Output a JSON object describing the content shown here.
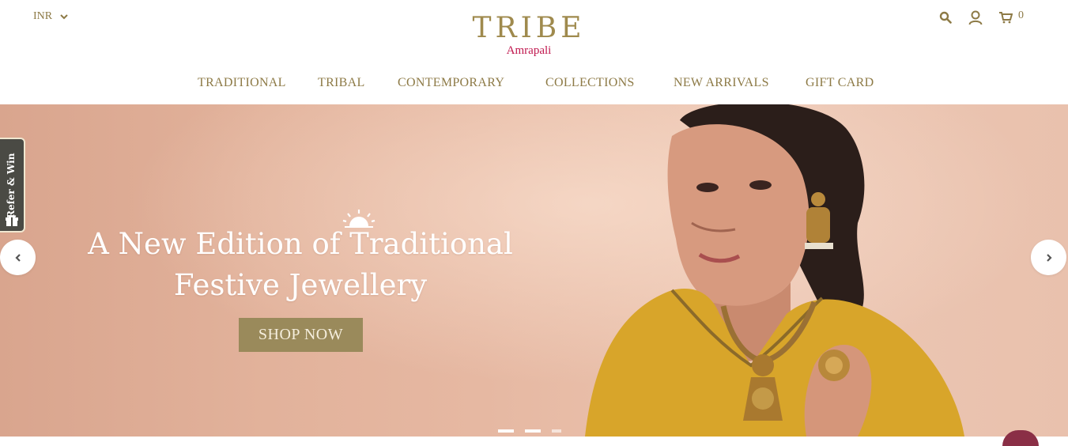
{
  "header": {
    "currency": "INR",
    "logo_main": "TRIBE",
    "logo_sub": "Amrapali",
    "cart_count": "0"
  },
  "nav": {
    "items": [
      {
        "label": "TRADITIONAL"
      },
      {
        "label": "TRIBAL"
      },
      {
        "label": "CONTEMPORARY"
      },
      {
        "label": "COLLECTIONS"
      },
      {
        "label": "NEW ARRIVALS"
      },
      {
        "label": "GIFT CARD"
      }
    ]
  },
  "hero": {
    "title_line1": "A New Edition of Traditional",
    "title_line2": "Festive Jewellery",
    "cta_label": "SHOP NOW",
    "slide_count": 3,
    "active_slide": 1
  },
  "refer_widget": {
    "label": "Refer & Win"
  },
  "icons": {
    "search": "search-icon",
    "account": "user-icon",
    "cart": "cart-icon",
    "prev": "chevron-left-icon",
    "next": "chevron-right-icon",
    "gift": "gift-icon"
  },
  "colors": {
    "brand_gold": "#9f8a4d",
    "brand_pink": "#c0174e",
    "cta_bg": "#9a8a5b",
    "hero_bg": "#e6b8a2"
  }
}
